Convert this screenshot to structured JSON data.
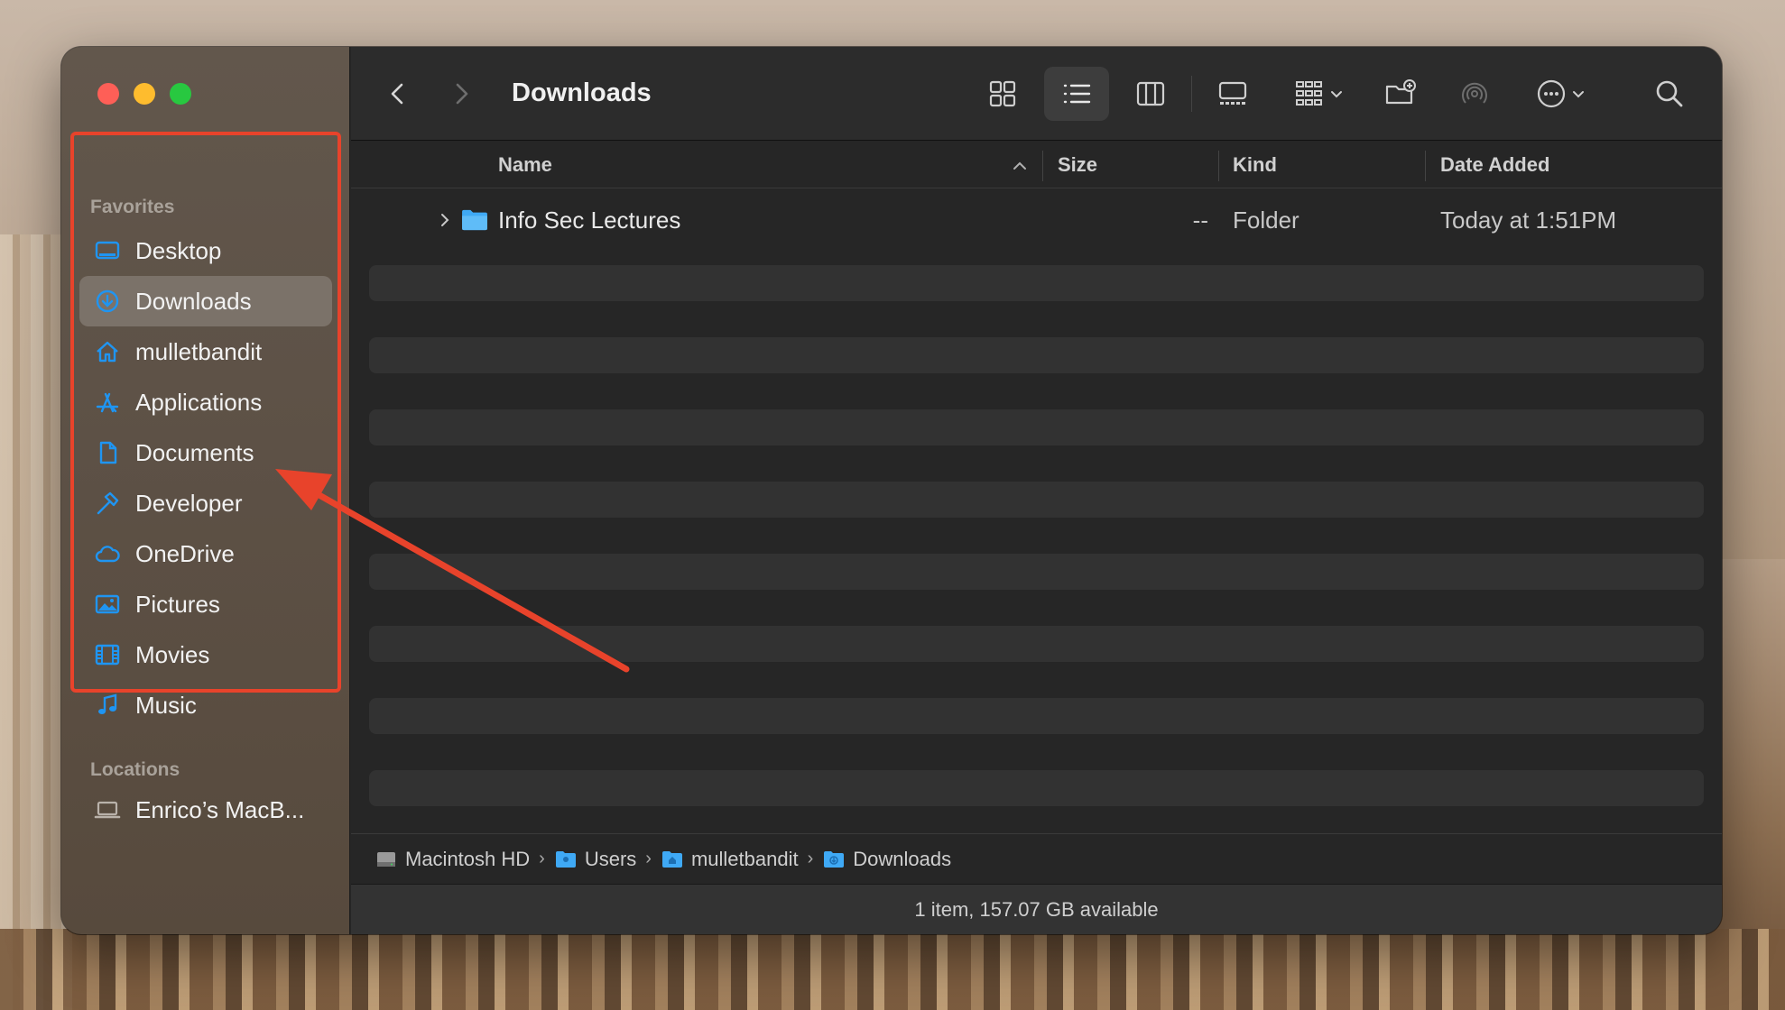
{
  "window": {
    "title": "Downloads"
  },
  "sidebar": {
    "favorites_title": "Favorites",
    "favorites": [
      {
        "label": "Desktop",
        "icon": "desktop-icon"
      },
      {
        "label": "Downloads",
        "icon": "downloads-icon",
        "active": true
      },
      {
        "label": "mulletbandit",
        "icon": "home-icon"
      },
      {
        "label": "Applications",
        "icon": "applications-icon"
      },
      {
        "label": "Documents",
        "icon": "document-icon"
      },
      {
        "label": "Developer",
        "icon": "hammer-icon"
      },
      {
        "label": "OneDrive",
        "icon": "cloud-icon"
      },
      {
        "label": "Pictures",
        "icon": "photo-icon"
      },
      {
        "label": "Movies",
        "icon": "film-icon"
      },
      {
        "label": "Music",
        "icon": "music-note-icon"
      }
    ],
    "locations_title": "Locations",
    "locations": [
      {
        "label": "Enrico’s MacB...",
        "icon": "laptop-icon"
      }
    ]
  },
  "toolbar": {
    "back": "back-chevron-icon",
    "forward": "forward-chevron-icon",
    "view_modes": [
      "icon-view-icon",
      "list-view-icon",
      "column-view-icon",
      "gallery-view-icon"
    ],
    "group": "group-icon",
    "new_folder": "new-folder-icon",
    "airdrop": "airdrop-icon",
    "more": "more-icon",
    "search": "search-icon"
  },
  "columns": {
    "name": "Name",
    "size": "Size",
    "kind": "Kind",
    "date_added": "Date Added"
  },
  "files": [
    {
      "name": "Info Sec Lectures",
      "size": "--",
      "kind": "Folder",
      "date_added": "Today at 1:51PM"
    }
  ],
  "pathbar": {
    "crumbs": [
      "Macintosh HD",
      "Users",
      "mulletbandit",
      "Downloads"
    ],
    "separator": "›"
  },
  "status": {
    "text": "1 item, 157.07 GB available"
  },
  "colors": {
    "accent": "#1f95f2",
    "annotation": "#e8432b",
    "close": "#fe5f57",
    "minimize": "#febc2e",
    "maximize": "#28c840"
  }
}
